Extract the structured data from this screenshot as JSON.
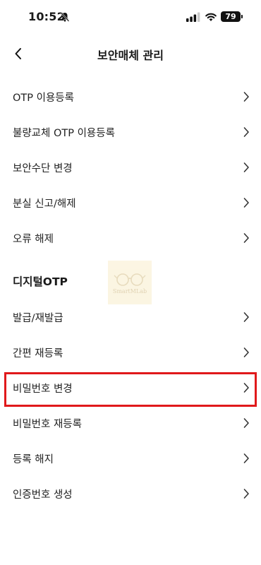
{
  "status_bar": {
    "time": "10:52",
    "battery": "79",
    "icons": [
      "bell-slash-icon",
      "signal-icon",
      "wifi-icon",
      "battery-icon"
    ]
  },
  "header": {
    "title": "보안매체 관리",
    "back_icon": "chevron-left-icon"
  },
  "menu_group_1": [
    {
      "label": "OTP 이용등록"
    },
    {
      "label": "불량교체 OTP 이용등록"
    },
    {
      "label": "보안수단 변경"
    },
    {
      "label": "분실 신고/해제"
    },
    {
      "label": "오류 해제"
    }
  ],
  "section_title": "디지털OTP",
  "menu_group_2": [
    {
      "label": "발급/재발급"
    },
    {
      "label": "간편 재등록"
    },
    {
      "label": "비밀번호 변경",
      "highlighted": true
    },
    {
      "label": "비밀번호 재등록"
    },
    {
      "label": "등록 해지"
    },
    {
      "label": "인증번호 생성"
    }
  ],
  "watermark": {
    "text": "SmartMLab"
  },
  "colors": {
    "highlight_border": "#e0191b",
    "text": "#222222",
    "chevron": "#333333"
  }
}
